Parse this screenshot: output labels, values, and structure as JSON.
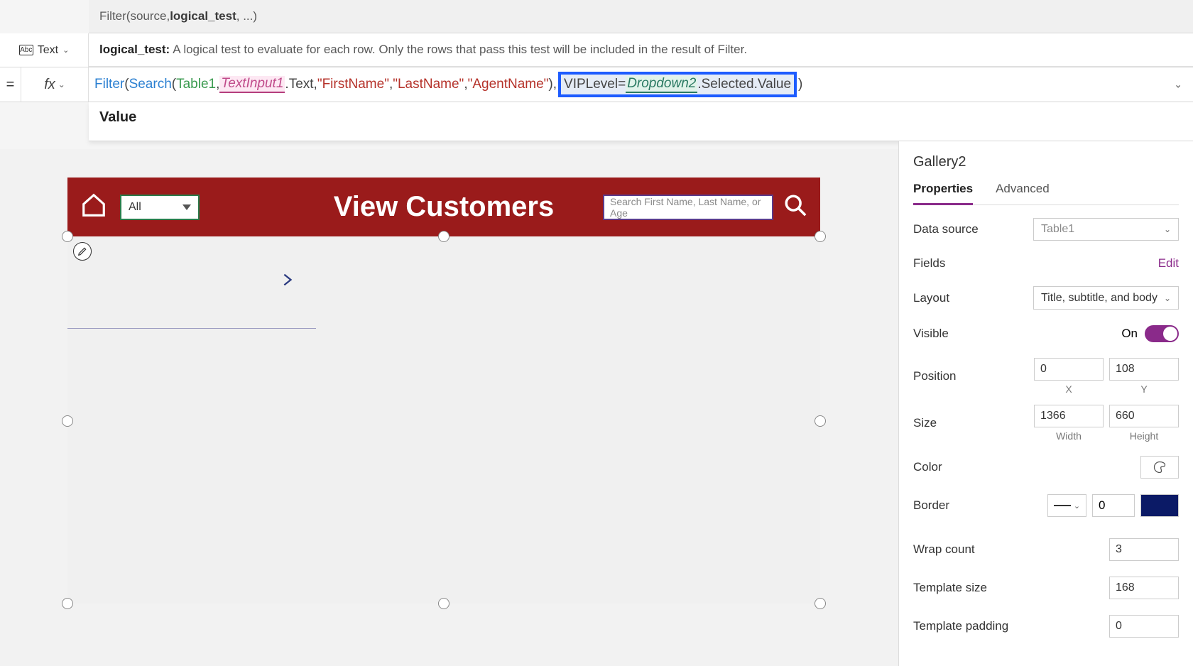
{
  "signature": {
    "fn": "Filter",
    "open": "(source, ",
    "bold_arg": "logical_test",
    "rest": ", ...)"
  },
  "hint": {
    "label": "logical_test:",
    "text": "A logical test to evaluate for each row. Only the rows that pass this test will be included in the result of Filter."
  },
  "format": {
    "icon": "Abc",
    "label": "Text",
    "chev": "⌄"
  },
  "formula": {
    "eq": "=",
    "fx": "fx",
    "fx_chev": "⌄",
    "t_filter": "Filter",
    "p1": "(",
    "t_search": "Search",
    "p2": "(",
    "t_table": "Table1",
    "c1": ", ",
    "t_input": "TextInput1",
    "t_text": ".Text",
    "c2": ", ",
    "s1": "\"FirstName\"",
    "c3": ", ",
    "s2": "\"LastName\"",
    "c4": ", ",
    "s3": "\"AgentName\"",
    "p3": ")",
    "c5": ", ",
    "sel_vip": "VIPLevel",
    "sel_eq": " = ",
    "sel_dd": "Dropdown2",
    "sel_rest": ".Selected.Value",
    "p4": ")",
    "expand_chev": "⌄"
  },
  "intellisense": {
    "item": "Value"
  },
  "app": {
    "dd_value": "All",
    "title": "View Customers",
    "search_placeholder": "Search First Name, Last Name, or Age"
  },
  "props": {
    "selected": "Gallery2",
    "tab_properties": "Properties",
    "tab_advanced": "Advanced",
    "data_source_label": "Data source",
    "data_source_value": "Table1",
    "fields_label": "Fields",
    "fields_edit": "Edit",
    "layout_label": "Layout",
    "layout_value": "Title, subtitle, and body",
    "visible_label": "Visible",
    "visible_value": "On",
    "position_label": "Position",
    "pos_x": "0",
    "pos_y": "108",
    "pos_x_lbl": "X",
    "pos_y_lbl": "Y",
    "size_label": "Size",
    "size_w": "1366",
    "size_h": "660",
    "size_w_lbl": "Width",
    "size_h_lbl": "Height",
    "color_label": "Color",
    "border_label": "Border",
    "border_w": "0",
    "wrap_label": "Wrap count",
    "wrap_val": "3",
    "tmpl_size_label": "Template size",
    "tmpl_size_val": "168",
    "tmpl_pad_label": "Template padding",
    "tmpl_pad_val": "0"
  }
}
